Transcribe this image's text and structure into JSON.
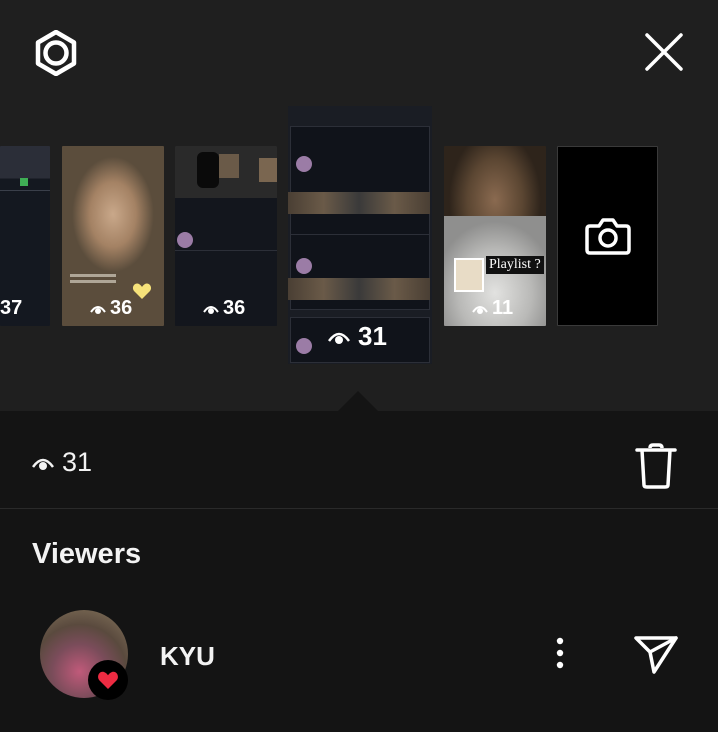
{
  "header": {
    "settings_icon": "gear-icon",
    "close_icon": "close-icon"
  },
  "stories": [
    {
      "views": "37"
    },
    {
      "views": "36"
    },
    {
      "views": "36"
    },
    {
      "views": "31",
      "selected": true
    },
    {
      "views": "11",
      "label": "Playlist ?"
    },
    {
      "camera": true
    }
  ],
  "selected_story": {
    "views": "31",
    "delete_icon": "trash-icon"
  },
  "viewers": {
    "title": "Viewers",
    "items": [
      {
        "username": "KYU",
        "liked": true
      }
    ]
  },
  "colors": {
    "background": "#141414",
    "top_background": "#1f1f1f",
    "heart": "#ed2b42",
    "text": "#f3f3f3"
  }
}
